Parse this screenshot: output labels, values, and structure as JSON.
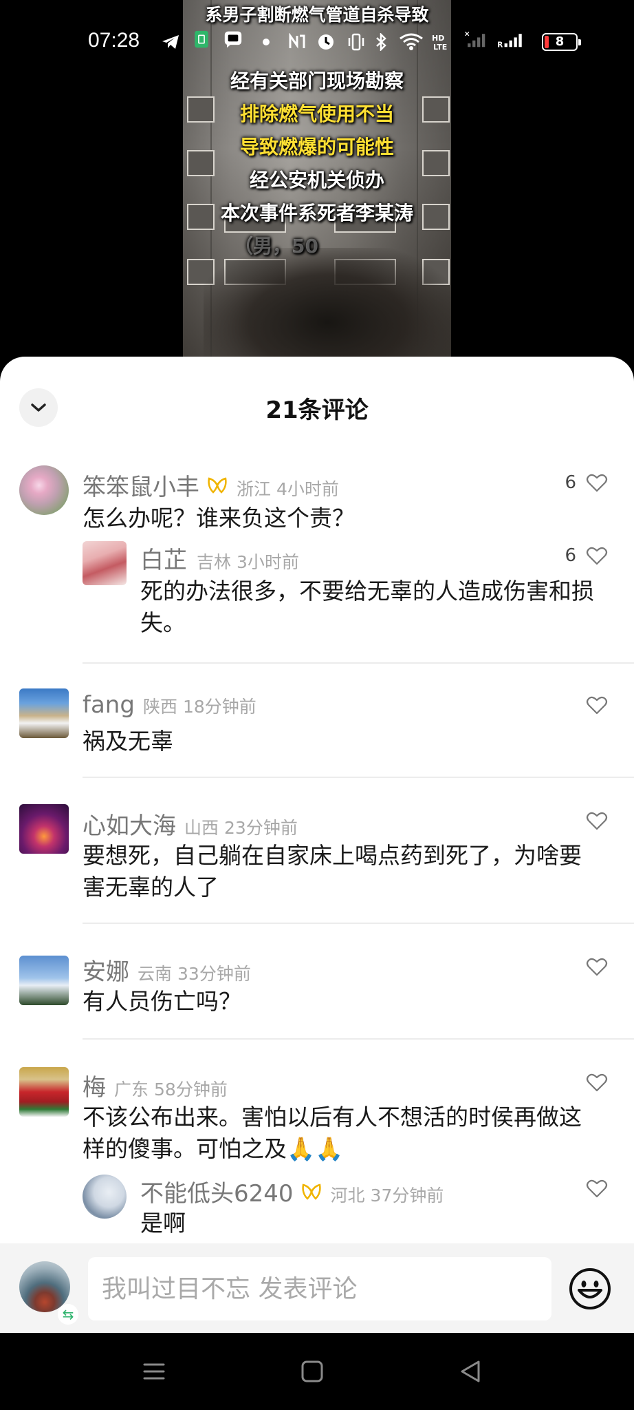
{
  "status_bar": {
    "time": "07:28",
    "battery_level": "8",
    "battery_color": "#ff3b3b",
    "icons": [
      "telegram-icon",
      "sim-icon",
      "message-icon",
      "dot-icon",
      "nfc-icon",
      "clock-icon",
      "vibrate-icon",
      "bluetooth-icon",
      "wifi-icon",
      "volte-icon",
      "signal-icon",
      "signal-r-icon",
      "battery-icon"
    ]
  },
  "video": {
    "caption_lines": [
      "系男子割断燃气管道自杀导致",
      "经有关部门现场勘察",
      "排除燃气使用不当",
      "导致燃爆的可能性",
      "经公安机关侦办",
      "本次事件系死者李某涛",
      "（男，50"
    ]
  },
  "sheet": {
    "title": "21条评论"
  },
  "comments": [
    {
      "user": "笨笨鼠小丰",
      "region": "浙江",
      "time": "4小时前",
      "text": "怎么办呢？谁来负这个责？",
      "likes": "6",
      "replies": [
        {
          "user": "白芷",
          "region": "吉林",
          "time": "3小时前",
          "text_line1": "死的办法很多，不要给无辜的人造成伤害和损",
          "text_line2": "失。",
          "likes": "6"
        }
      ]
    },
    {
      "user": "fang",
      "region": "陕西",
      "time": "18分钟前",
      "text": "祸及无辜"
    },
    {
      "user": "心如大海",
      "region": "山西",
      "time": "23分钟前",
      "text_line1": "要想死，自己躺在自家床上喝点药到死了，为啥要",
      "text_line2": "害无辜的人了"
    },
    {
      "user": "安娜",
      "region": "云南",
      "time": "33分钟前",
      "text": "有人员伤亡吗？"
    },
    {
      "user": "梅",
      "region": "广东",
      "time": "58分钟前",
      "text_line1": "不该公布出来。害怕以后有人不想活的时侯再做这",
      "text_line2": "样的傻事。可怕之及🙏🙏",
      "replies": [
        {
          "user": "不能低头6240",
          "region": "河北",
          "time": "37分钟前",
          "text": "是啊"
        }
      ]
    }
  ],
  "input_bar": {
    "placeholder": "我叫过目不忘 发表评论"
  },
  "colors": {
    "caption_yellow": "#ffe033",
    "badge_gold": "#f0b400",
    "reply_swap_green": "#2bb26b"
  }
}
